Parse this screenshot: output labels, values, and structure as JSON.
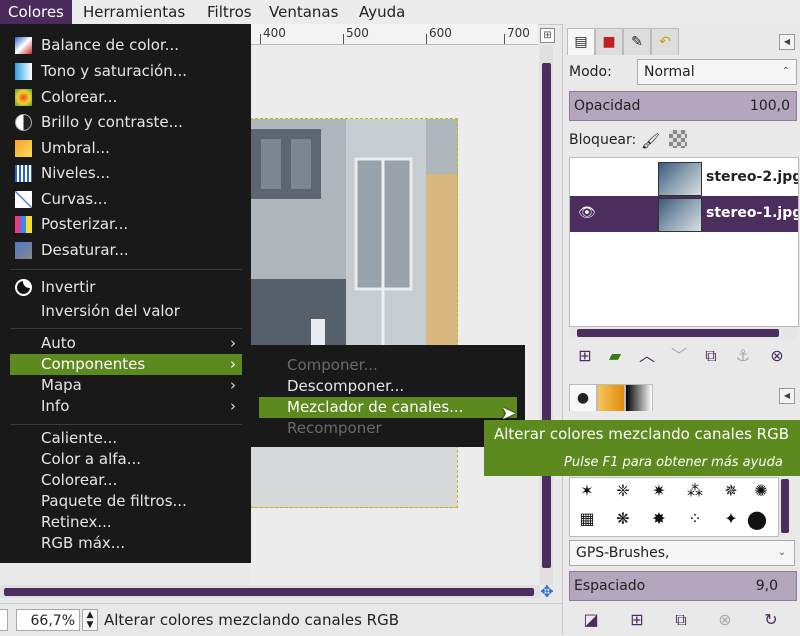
{
  "menubar": {
    "items": [
      "Colores",
      "Herramientas",
      "Filtros",
      "Ventanas",
      "Ayuda"
    ],
    "active": "Colores"
  },
  "ruler": {
    "ticks": [
      "400",
      "500",
      "600",
      "700"
    ]
  },
  "colores_menu": {
    "group1": [
      {
        "label": "Balance de color...",
        "icon": "color-balance-icon"
      },
      {
        "label": "Tono y saturación...",
        "icon": "hue-saturation-icon"
      },
      {
        "label": "Colorear...",
        "icon": "colorize-icon"
      },
      {
        "label": "Brillo y contraste...",
        "icon": "brightness-contrast-icon"
      },
      {
        "label": "Umbral...",
        "icon": "threshold-icon"
      },
      {
        "label": "Niveles...",
        "icon": "levels-icon"
      },
      {
        "label": "Curvas...",
        "icon": "curves-icon"
      },
      {
        "label": "Posterizar...",
        "icon": "posterize-icon"
      },
      {
        "label": "Desaturar...",
        "icon": "desaturate-icon"
      }
    ],
    "group2": [
      {
        "label": "Invertir",
        "icon": "invert-icon"
      },
      {
        "label": "Inversión del valor"
      }
    ],
    "group3": [
      {
        "label": "Auto"
      },
      {
        "label": "Componentes"
      },
      {
        "label": "Mapa"
      },
      {
        "label": "Info"
      }
    ],
    "group4": [
      {
        "label": "Caliente..."
      },
      {
        "label": "Color a alfa..."
      },
      {
        "label": "Colorear..."
      },
      {
        "label": "Paquete de filtros..."
      },
      {
        "label": "Retinex..."
      },
      {
        "label": "RGB máx..."
      }
    ],
    "submenu_arrow": "›"
  },
  "componentes_submenu": [
    {
      "label": "Componer...",
      "enabled": false
    },
    {
      "label": "Descomponer...",
      "enabled": true
    },
    {
      "label": "Mezclador de canales...",
      "enabled": true
    },
    {
      "label": "Recomponer",
      "enabled": false
    }
  ],
  "tooltip": {
    "main": "Alterar colores mezclando canales RGB",
    "hint": "Pulse F1 para obtener más ayuda"
  },
  "statusbar": {
    "zoom": "66,7%",
    "message": "Alterar colores mezclando canales RGB"
  },
  "layers": {
    "mode_label": "Modo:",
    "mode_value": "Normal",
    "opacity_label": "Opacidad",
    "opacity_value": "100,0",
    "lock_label": "Bloquear:",
    "items": [
      {
        "name": "stereo-2.jpg",
        "visible": false,
        "selected": false
      },
      {
        "name": "stereo-1.jpg",
        "visible": true,
        "selected": true
      }
    ]
  },
  "brushes": {
    "selected": "GPS-Brushes,",
    "spacing_label": "Espaciado",
    "spacing_value": "9,0"
  },
  "colors": {
    "menu_bg": "#191919",
    "highlight": "#5d8a1e",
    "accent": "#4b2d5e"
  }
}
